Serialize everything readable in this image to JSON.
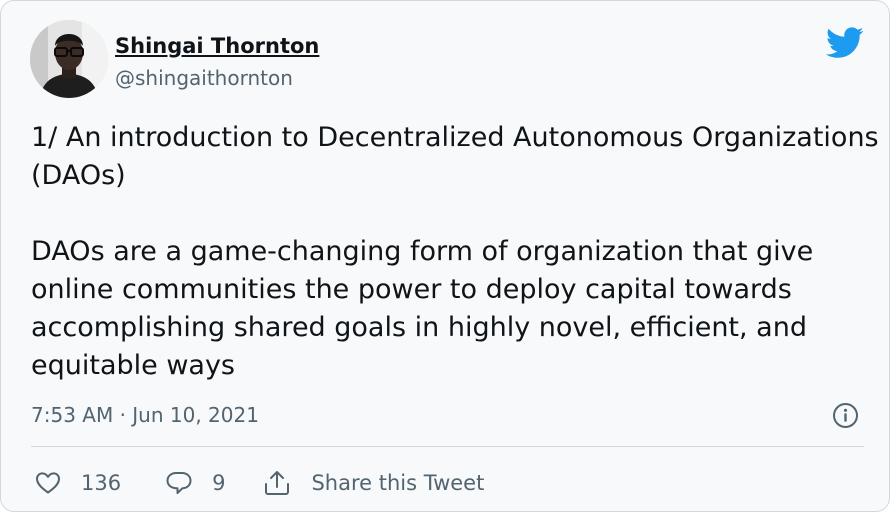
{
  "author": {
    "name": "Shingai Thornton",
    "handle": "@shingaithornton"
  },
  "tweet": {
    "paragraphs": [
      "1/ An introduction to Decentralized Autonomous Organizations (DAOs)",
      "DAOs are a game-changing form of organization that give online communities the power to deploy capital towards accomplishing shared goals in highly novel, efficient, and equitable ways"
    ],
    "timestamp": "7:53 AM · Jun 10, 2021"
  },
  "actions": {
    "like_count": "136",
    "reply_count": "9",
    "share_label": "Share this Tweet"
  },
  "icons": {
    "brand": "twitter-bird-icon",
    "like": "heart-icon",
    "reply": "speech-bubble-icon",
    "share": "share-upload-icon",
    "info": "info-icon"
  },
  "colors": {
    "brand_blue": "#1d9bf0",
    "text_primary": "#0f1419",
    "text_secondary": "#536471",
    "card_background": "#f7f9fa",
    "border": "#cfd9de"
  }
}
